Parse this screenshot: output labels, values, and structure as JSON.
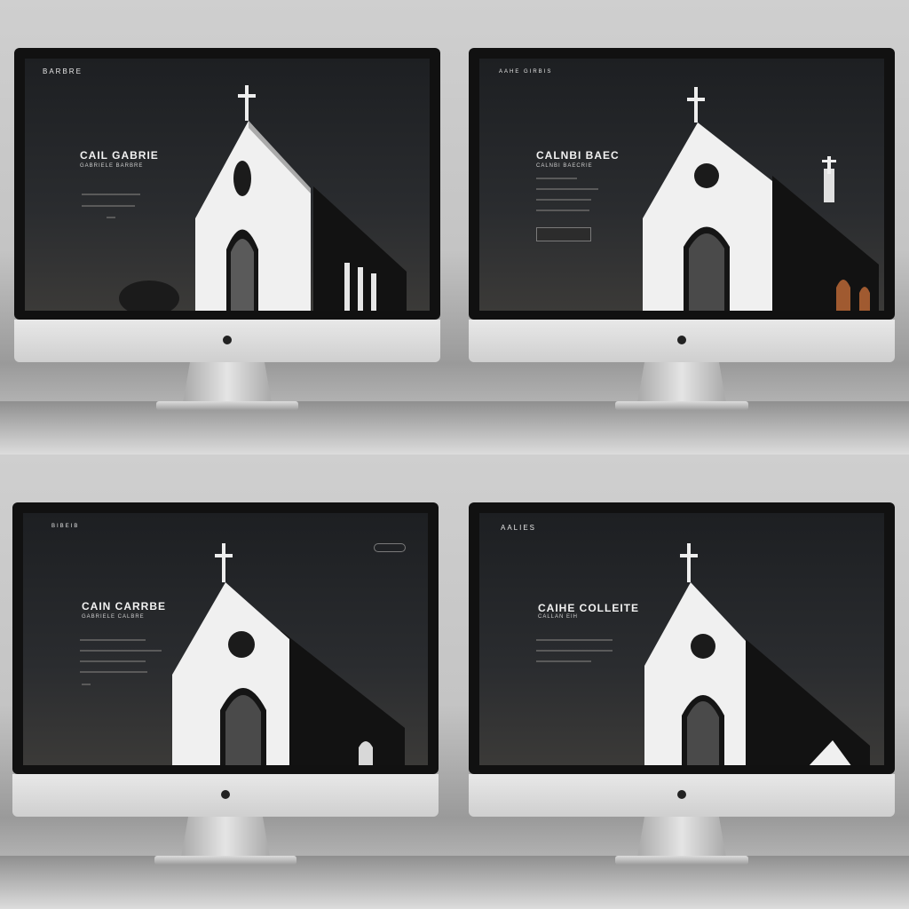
{
  "panels": [
    {
      "brand": "BARBRE",
      "title": "CAIL GABRIE",
      "subtitle": "GABRIELE BARBRE",
      "nav": [
        "",
        "",
        "",
        ""
      ]
    },
    {
      "brand": "AAHE GIRBIS",
      "title": "CALNBI BAEC",
      "subtitle": "CALNBI BAECRIE",
      "cta": ""
    },
    {
      "brand": "BIBEIB",
      "title": "CAIN CARRBE",
      "subtitle": "GABRIELE CALBRE",
      "cta": ""
    },
    {
      "brand": "AALIES",
      "title": "CAIHE COLLEITE",
      "subtitle": "CALLAN EIH"
    }
  ],
  "colors": {
    "screen": "#1d1f22",
    "church": "#f2f2f2",
    "bezel": "#111111"
  }
}
